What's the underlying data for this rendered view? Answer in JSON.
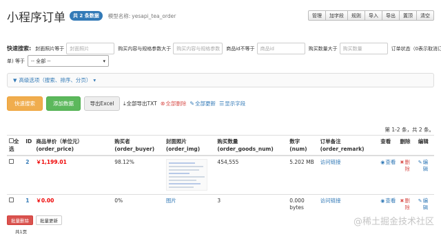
{
  "header": {
    "title": "小程序订单",
    "total_badge": "共 2 条数据",
    "model_label": "模型名称:",
    "model_value": "yesapi_tea_order"
  },
  "toolbar": [
    "管理",
    "加字段",
    "规则",
    "导入",
    "导出",
    "置顶",
    "清空"
  ],
  "search": {
    "label": "快速搜索:",
    "img_label": "封面照片等于",
    "img_placeholder": "封面照片",
    "content_label": "购买内容与规格参数大于",
    "content_placeholder": "购买内容与规格参数",
    "goods_label": "商品id不等于",
    "goods_placeholder": "商品id",
    "num_label": "购买数量大于",
    "num_placeholder": "购买数量",
    "status_label": "订单状态（0表示取消订单）等于",
    "status_value": "-- 全部 --"
  },
  "advanced": "高级选项（搜索、排序、分页）",
  "actions": {
    "search": "快速搜索",
    "add": "添加数据",
    "export": "导出Excel",
    "export_txt": "全部导出TXT",
    "delete_all": "全部删除",
    "update_all": "全部更新",
    "show_fields": "显示字段"
  },
  "pageinfo": "第 1-2 条，共 2 条。",
  "table": {
    "headers": {
      "check": "全选",
      "id": "ID",
      "price": "商品单价（单位元）(order_price)",
      "buyer": "购买者 (order_buyer)",
      "img": "封面照片 (order_img)",
      "num": "购买数量 (order_goods_num)",
      "digit": "数字(num)",
      "remark": "订单备注 (order_remark)",
      "view": "查看",
      "del": "删除",
      "edit": "编辑"
    },
    "rows": [
      {
        "id": "2",
        "price": "￥1,199.01",
        "buyer": "98.12%",
        "img": "",
        "num": "454,555",
        "digit": "5.202 MB",
        "remark": "访问链接",
        "view": "查看",
        "del": "删除",
        "edit": "编辑"
      },
      {
        "id": "1",
        "price": "￥0.00",
        "buyer": "0%",
        "img": "图片",
        "num": "3",
        "digit": "0.000 bytes",
        "remark": "访问链接",
        "view": "查看",
        "del": "删除",
        "edit": "编辑"
      }
    ]
  },
  "bottom": {
    "batch_delete": "批量删除",
    "batch_update": "批量更新",
    "page_count": "共1页"
  },
  "watermark": "@稀土掘金技术社区",
  "icons": {
    "funnel": "funnel-icon",
    "download": "download-icon",
    "remove": "remove-circle-icon",
    "edit": "edit-icon",
    "list": "list-icon",
    "eye": "eye-icon",
    "times": "times-icon",
    "pencil": "pencil-icon"
  },
  "colors": {
    "primary": "#337ab7",
    "orange": "#f0ad4e",
    "green": "#5cb85c",
    "danger": "#d9534f",
    "price": "#e00000"
  }
}
